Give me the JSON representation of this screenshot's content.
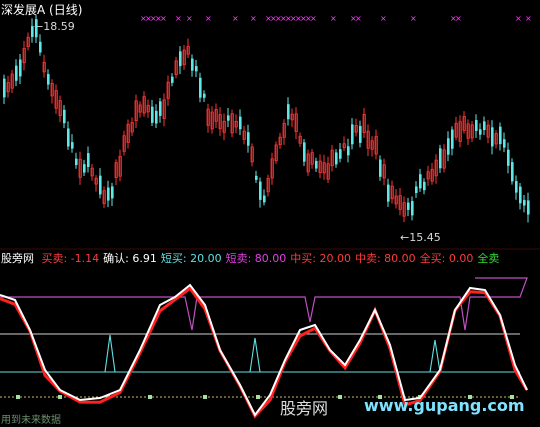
{
  "window": {
    "title": "深发展A (日线)"
  },
  "price_panel": {
    "high_marker": "←18.59",
    "low_marker": "←15.45"
  },
  "indicator_bar": {
    "name": "股旁网",
    "items": [
      {
        "label": "买卖:",
        "value": "-1.14",
        "color": "#ff3b3b"
      },
      {
        "label": "确认:",
        "value": "6.91",
        "color": "#ffffff"
      },
      {
        "label": "短买:",
        "value": "20.00",
        "color": "#5fe0e0"
      },
      {
        "label": "短卖:",
        "value": "80.00",
        "color": "#e040e0"
      },
      {
        "label": "中买:",
        "value": "20.00",
        "color": "#ff3b3b"
      },
      {
        "label": "中卖:",
        "value": "80.00",
        "color": "#ff3b3b"
      },
      {
        "label": "全买:",
        "value": "0.00",
        "color": "#ff3b3b"
      },
      {
        "label": "全卖",
        "value": "",
        "color": "#33dd33"
      }
    ]
  },
  "watermark": {
    "text": "股旁网",
    "url": "www.gupang.com"
  },
  "footer": {
    "text": "用到未来数据"
  },
  "colors": {
    "up": "#ff3333",
    "down": "#5fe8e8",
    "short_line": "#c050c0",
    "buy_line": "#ff2020",
    "confirm_line": "#ffffff",
    "cross": "#ff40ff"
  }
}
